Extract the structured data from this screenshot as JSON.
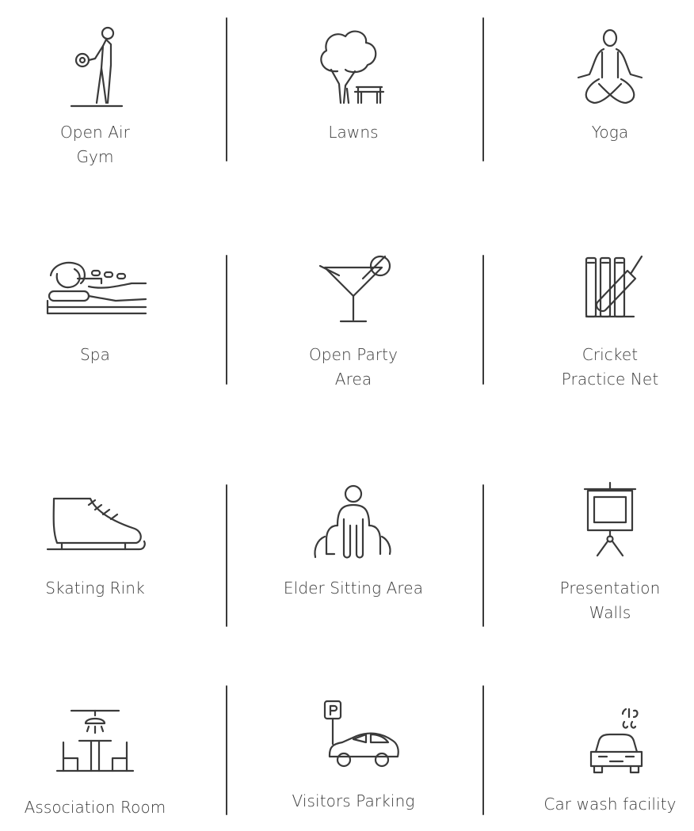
{
  "amenities": [
    {
      "label": "Open Air\nGym",
      "icon": "open-air-gym-icon"
    },
    {
      "label": "Lawns",
      "icon": "lawns-icon"
    },
    {
      "label": "Yoga",
      "icon": "yoga-icon"
    },
    {
      "label": "Spa",
      "icon": "spa-icon"
    },
    {
      "label": "Open Party\nArea",
      "icon": "party-cocktail-icon"
    },
    {
      "label": "Cricket\nPractice Net",
      "icon": "cricket-net-icon"
    },
    {
      "label": "Skating Rink",
      "icon": "skate-icon"
    },
    {
      "label": "Elder Sitting Area",
      "icon": "elder-sitting-icon"
    },
    {
      "label": "Presentation\nWalls",
      "icon": "presentation-board-icon"
    },
    {
      "label": "Association Room",
      "icon": "association-room-icon"
    },
    {
      "label": "Visitors Parking",
      "icon": "parking-car-icon"
    },
    {
      "label": "Car wash facility",
      "icon": "car-wash-icon"
    }
  ],
  "colors": {
    "ink": "#3a3a3a",
    "background": "#ffffff"
  }
}
